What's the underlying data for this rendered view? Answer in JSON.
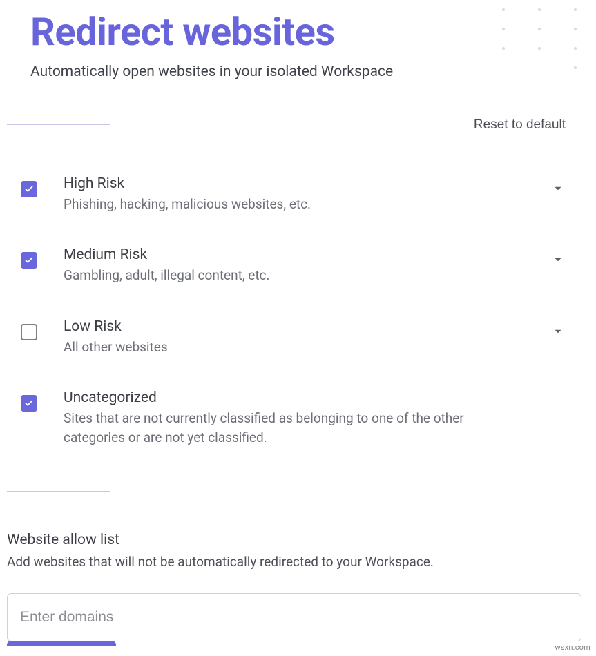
{
  "header": {
    "title": "Redirect websites",
    "subtitle": "Automatically open websites in your isolated Workspace"
  },
  "actions": {
    "reset_label": "Reset to default"
  },
  "categories": [
    {
      "id": "high-risk",
      "checked": true,
      "expandable": true,
      "title": "High Risk",
      "desc": "Phishing, hacking, malicious websites, etc."
    },
    {
      "id": "medium-risk",
      "checked": true,
      "expandable": true,
      "title": "Medium Risk",
      "desc": "Gambling, adult, illegal content, etc."
    },
    {
      "id": "low-risk",
      "checked": false,
      "expandable": true,
      "title": "Low Risk",
      "desc": "All other websites"
    },
    {
      "id": "uncategorized",
      "checked": true,
      "expandable": false,
      "title": "Uncategorized",
      "desc": "Sites that are not currently classified as belonging to one of the other categories or are not yet classified."
    }
  ],
  "allow_list": {
    "title": "Website allow list",
    "subtitle": "Add websites that will not be automatically redirected to your Workspace.",
    "placeholder": "Enter domains",
    "value": ""
  },
  "watermark": "wsxn.com"
}
